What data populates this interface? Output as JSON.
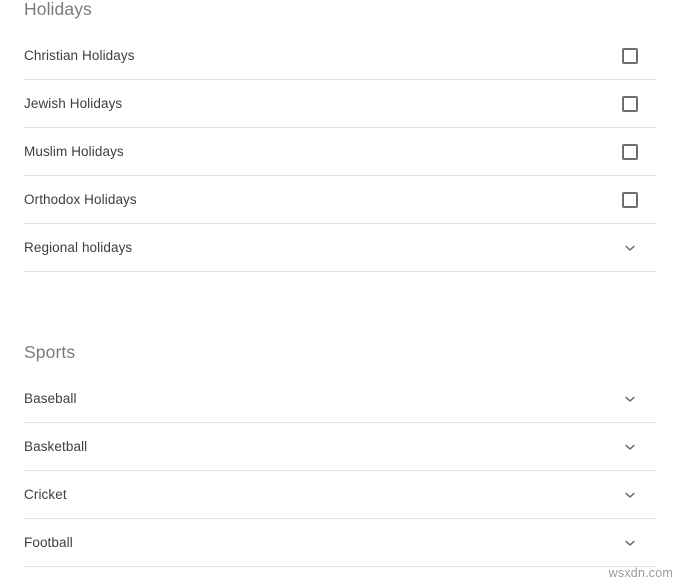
{
  "sections": [
    {
      "id": "holidays",
      "heading": "Holidays",
      "items": [
        {
          "label": "Christian Holidays",
          "control": "checkbox",
          "checked": false,
          "icon": "checkbox-unchecked-icon"
        },
        {
          "label": "Jewish Holidays",
          "control": "checkbox",
          "checked": false,
          "icon": "checkbox-unchecked-icon"
        },
        {
          "label": "Muslim Holidays",
          "control": "checkbox",
          "checked": false,
          "icon": "checkbox-unchecked-icon"
        },
        {
          "label": "Orthodox Holidays",
          "control": "checkbox",
          "checked": false,
          "icon": "checkbox-unchecked-icon"
        },
        {
          "label": "Regional holidays",
          "control": "chevron",
          "expanded": false,
          "icon": "chevron-down-icon"
        }
      ]
    },
    {
      "id": "sports",
      "heading": "Sports",
      "items": [
        {
          "label": "Baseball",
          "control": "chevron",
          "expanded": false,
          "icon": "chevron-down-icon"
        },
        {
          "label": "Basketball",
          "control": "chevron",
          "expanded": false,
          "icon": "chevron-down-icon"
        },
        {
          "label": "Cricket",
          "control": "chevron",
          "expanded": false,
          "icon": "chevron-down-icon"
        },
        {
          "label": "Football",
          "control": "chevron",
          "expanded": false,
          "icon": "chevron-down-icon"
        }
      ]
    }
  ],
  "watermark": "wsxdn.com",
  "colors": {
    "background": "#ffffff",
    "heading_text": "#7b7b7b",
    "label_text": "#3c4043",
    "divider": "#e4e4e4",
    "checkbox_border": "#6e6e6e",
    "chevron": "#5f6368",
    "watermark_text": "#9a9a9a"
  }
}
